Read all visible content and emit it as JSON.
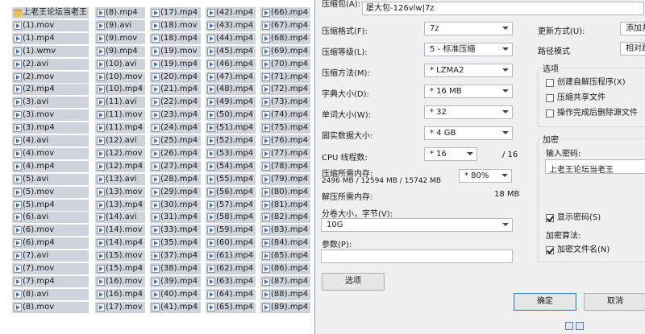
{
  "explorer": {
    "columns": [
      [
        "上老王论坛当老王",
        "(1).mov",
        "(1).mp4",
        "(1).wmv",
        "(2).avi",
        "(2).mov",
        "(2).mp4",
        "(3).avi",
        "(3).mov",
        "(3).mp4",
        "(4).avi",
        "(4).mov",
        "(4).mp4",
        "(5).avi",
        "(5).mov",
        "(5).mp4",
        "(6).avi",
        "(6).mov",
        "(6).mp4",
        "(7).avi",
        "(7).mov",
        "(7).mp4",
        "(8).avi",
        "(8).mov"
      ],
      [
        "(8).mp4",
        "(9).avi",
        "(9).mov",
        "(9).mp4",
        "(10).avi",
        "(10).mov",
        "(10).mp4",
        "(11).avi",
        "(11).mov",
        "(11).mp4",
        "(12).avi",
        "(12).mov",
        "(12).mp4",
        "(13).avi",
        "(13).mov",
        "(13).mp4",
        "(14).avi",
        "(14).mov",
        "(14).mp4",
        "(15).mov",
        "(15).mp4",
        "(16).mov",
        "(16).mp4",
        "(17).mov"
      ],
      [
        "(17).mp4",
        "(18).mov",
        "(18).mp4",
        "(19).mov",
        "(19).mp4",
        "(20).mp4",
        "(21).mp4",
        "(22).mp4",
        "(23).mp4",
        "(24).mp4",
        "(25).mp4",
        "(26).mp4",
        "(27).mp4",
        "(28).mp4",
        "(29).mp4",
        "(30).mp4",
        "(31).mp4",
        "(33).mp4",
        "(35).mp4",
        "(37).mp4",
        "(38).mp4",
        "(39).mp4",
        "(40).mp4",
        "(41).mp4"
      ],
      [
        "(42).mp4",
        "(43).mp4",
        "(44).mp4",
        "(45).mp4",
        "(46).mp4",
        "(47).mp4",
        "(48).mp4",
        "(49).mp4",
        "(50).mp4",
        "(51).mp4",
        "(52).mp4",
        "(53).mp4",
        "(54).mp4",
        "(55).mp4",
        "(56).mp4",
        "(57).mp4",
        "(58).mp4",
        "(59).mp4",
        "(60).mp4",
        "(61).mp4",
        "(62).mp4",
        "(63).mp4",
        "(64).mp4",
        "(65).mp4"
      ],
      [
        "(66).mp4",
        "(67).mp4",
        "(68).mp4",
        "(69).mp4",
        "(70).mp4",
        "(71).mp4",
        "(72).mp4",
        "(73).mp4",
        "(74).mp4",
        "(75).mp4",
        "(76).mp4",
        "(77).mp4",
        "(78).mp4",
        "(79).mp4",
        "(80).mp4",
        "(81).mp4",
        "(82).mp4",
        "(83).mp4",
        "(84).mp4",
        "(85).mp4",
        "(86).mp4",
        "(87).mp4",
        "(88).mp4",
        "(89).mp4"
      ]
    ]
  },
  "dialog": {
    "archive_label": "压缩包(A):",
    "archive_value": "屡大包-126vlw|7z",
    "format_label": "压缩格式(F):",
    "format_value": "7z",
    "level_label": "压缩等级(L):",
    "level_value": "5 - 标准压缩",
    "method_label": "压缩方法(M):",
    "method_value": "* LZMA2",
    "dict_label": "字典大小(D):",
    "dict_value": "* 16 MB",
    "word_label": "单词大小(W):",
    "word_value": "* 32",
    "solid_label": "固实数据大小:",
    "solid_value": "* 4 GB",
    "cpu_label": "CPU 线程数:",
    "cpu_value": "* 16",
    "cpu_max": "/ 16",
    "mem_comp_label": "压缩所需内存:",
    "mem_comp_value": "2496 MB / 12594 MB / 15742 MB",
    "mem_percent": "* 80%",
    "mem_decomp_label": "解压所需内存:",
    "mem_decomp_value": "18 MB",
    "split_label": "分卷大小，字节(V):",
    "split_value": "10G",
    "params_label": "参数(P):",
    "params_value": "",
    "options_button": "选项",
    "update_label": "更新方式(U):",
    "update_value": "添加并",
    "path_label": "路径模式",
    "path_value": "相对路",
    "options_group": "选项",
    "opt_sfx": "创建自解压程序(X)",
    "opt_shared": "压缩共享文件",
    "opt_delete": "操作完成后删除源文件",
    "encrypt_group": "加密",
    "password_label": "输入密码:",
    "password_value": "上老王论坛当老王",
    "show_password": "显示密码(S)",
    "enc_method_label": "加密算法:",
    "enc_filenames": "加密文件名(N)",
    "ok_button": "确定",
    "cancel_button": "取消"
  }
}
